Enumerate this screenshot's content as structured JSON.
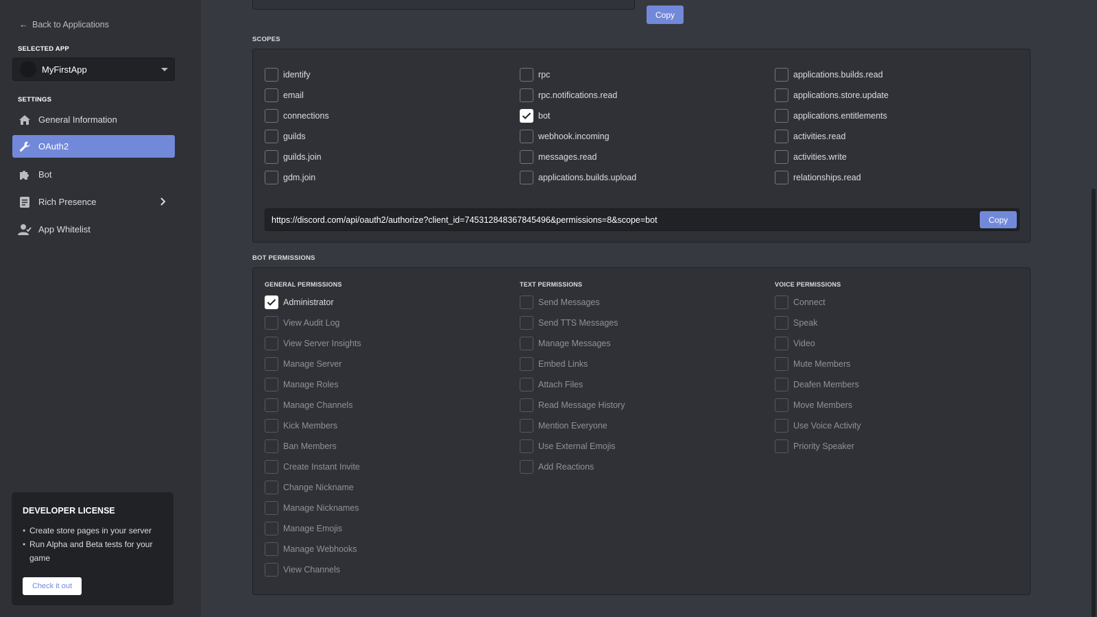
{
  "sidebar": {
    "back_label": "Back to Applications",
    "selected_app_heading": "SELECTED APP",
    "app_name": "MyFirstApp",
    "settings_heading": "SETTINGS",
    "items": [
      {
        "label": "General Information",
        "icon": "home-icon"
      },
      {
        "label": "OAuth2",
        "icon": "wrench-icon",
        "active": true
      },
      {
        "label": "Bot",
        "icon": "puzzle-icon"
      },
      {
        "label": "Rich Presence",
        "icon": "document-icon"
      },
      {
        "label": "App Whitelist",
        "icon": "user-check-icon"
      }
    ],
    "dev_license": {
      "title": "DEVELOPER LICENSE",
      "bullets": [
        "Create store pages in your server",
        "Run Alpha and Beta tests for your game"
      ],
      "button": "Check it out"
    }
  },
  "main": {
    "top_copy": "Copy",
    "scopes_heading": "SCOPES",
    "scopes": [
      [
        {
          "label": "identify",
          "checked": false
        },
        {
          "label": "email",
          "checked": false
        },
        {
          "label": "connections",
          "checked": false
        },
        {
          "label": "guilds",
          "checked": false
        },
        {
          "label": "guilds.join",
          "checked": false
        },
        {
          "label": "gdm.join",
          "checked": false
        }
      ],
      [
        {
          "label": "rpc",
          "checked": false
        },
        {
          "label": "rpc.notifications.read",
          "checked": false
        },
        {
          "label": "bot",
          "checked": true
        },
        {
          "label": "webhook.incoming",
          "checked": false
        },
        {
          "label": "messages.read",
          "checked": false
        },
        {
          "label": "applications.builds.upload",
          "checked": false
        }
      ],
      [
        {
          "label": "applications.builds.read",
          "checked": false
        },
        {
          "label": "applications.store.update",
          "checked": false
        },
        {
          "label": "applications.entitlements",
          "checked": false
        },
        {
          "label": "activities.read",
          "checked": false
        },
        {
          "label": "activities.write",
          "checked": false
        },
        {
          "label": "relationships.read",
          "checked": false
        }
      ]
    ],
    "url": "https://discord.com/api/oauth2/authorize?client_id=745312848367845496&permissions=8&scope=bot",
    "url_copy": "Copy",
    "bot_permissions_heading": "BOT PERMISSIONS",
    "permission_groups": [
      {
        "heading": "GENERAL PERMISSIONS",
        "items": [
          {
            "label": "Administrator",
            "checked": true
          },
          {
            "label": "View Audit Log",
            "checked": false
          },
          {
            "label": "View Server Insights",
            "checked": false
          },
          {
            "label": "Manage Server",
            "checked": false
          },
          {
            "label": "Manage Roles",
            "checked": false
          },
          {
            "label": "Manage Channels",
            "checked": false
          },
          {
            "label": "Kick Members",
            "checked": false
          },
          {
            "label": "Ban Members",
            "checked": false
          },
          {
            "label": "Create Instant Invite",
            "checked": false
          },
          {
            "label": "Change Nickname",
            "checked": false
          },
          {
            "label": "Manage Nicknames",
            "checked": false
          },
          {
            "label": "Manage Emojis",
            "checked": false
          },
          {
            "label": "Manage Webhooks",
            "checked": false
          },
          {
            "label": "View Channels",
            "checked": false
          }
        ]
      },
      {
        "heading": "TEXT PERMISSIONS",
        "items": [
          {
            "label": "Send Messages",
            "checked": false
          },
          {
            "label": "Send TTS Messages",
            "checked": false
          },
          {
            "label": "Manage Messages",
            "checked": false
          },
          {
            "label": "Embed Links",
            "checked": false
          },
          {
            "label": "Attach Files",
            "checked": false
          },
          {
            "label": "Read Message History",
            "checked": false
          },
          {
            "label": "Mention Everyone",
            "checked": false
          },
          {
            "label": "Use External Emojis",
            "checked": false
          },
          {
            "label": "Add Reactions",
            "checked": false
          }
        ]
      },
      {
        "heading": "VOICE PERMISSIONS",
        "items": [
          {
            "label": "Connect",
            "checked": false
          },
          {
            "label": "Speak",
            "checked": false
          },
          {
            "label": "Video",
            "checked": false
          },
          {
            "label": "Mute Members",
            "checked": false
          },
          {
            "label": "Deafen Members",
            "checked": false
          },
          {
            "label": "Move Members",
            "checked": false
          },
          {
            "label": "Use Voice Activity",
            "checked": false
          },
          {
            "label": "Priority Speaker",
            "checked": false
          }
        ]
      }
    ]
  },
  "colors": {
    "accent": "#7289da",
    "background": "#36393f",
    "sidebar": "#2f3136"
  }
}
